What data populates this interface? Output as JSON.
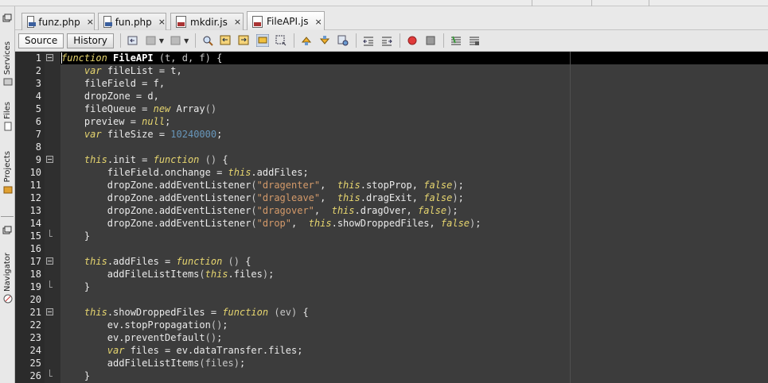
{
  "sidebar": {
    "tabs": [
      {
        "label": "Services"
      },
      {
        "label": "Files"
      },
      {
        "label": "Projects"
      },
      {
        "label": "Navigator"
      }
    ]
  },
  "tabs": [
    {
      "label": "funz.php",
      "close": "×",
      "type": "php"
    },
    {
      "label": "fun.php",
      "close": "×",
      "type": "php"
    },
    {
      "label": "mkdir.js",
      "close": "×",
      "type": "js"
    },
    {
      "label": "FileAPI.js",
      "close": "×",
      "type": "js",
      "active": true
    }
  ],
  "toolbar": {
    "source_label": "Source",
    "history_label": "History"
  },
  "editor": {
    "lines": [
      {
        "n": "1",
        "fold": "start",
        "tokens": [
          [
            "kw",
            "function"
          ],
          [
            "t",
            " "
          ],
          [
            "bold",
            "FileAPI"
          ],
          [
            "t",
            " "
          ],
          [
            "paren",
            "(t, d, f)"
          ],
          [
            "t",
            " {"
          ]
        ]
      },
      {
        "n": "2",
        "tokens": [
          [
            "t",
            "    "
          ],
          [
            "kw",
            "var"
          ],
          [
            "t",
            " fileList = t,"
          ]
        ]
      },
      {
        "n": "3",
        "tokens": [
          [
            "t",
            "    fileField = f,"
          ]
        ]
      },
      {
        "n": "4",
        "tokens": [
          [
            "t",
            "    dropZone = d,"
          ]
        ]
      },
      {
        "n": "5",
        "tokens": [
          [
            "t",
            "    fileQueue = "
          ],
          [
            "kw",
            "new"
          ],
          [
            "t",
            " Array"
          ],
          [
            "paren",
            "()"
          ]
        ]
      },
      {
        "n": "6",
        "tokens": [
          [
            "t",
            "    preview = "
          ],
          [
            "kw",
            "null"
          ],
          [
            "t",
            ";"
          ]
        ]
      },
      {
        "n": "7",
        "tokens": [
          [
            "t",
            "    "
          ],
          [
            "kw",
            "var"
          ],
          [
            "t",
            " fileSize = "
          ],
          [
            "num",
            "10240000"
          ],
          [
            "t",
            ";"
          ]
        ]
      },
      {
        "n": "8",
        "tokens": []
      },
      {
        "n": "9",
        "fold": "start",
        "tokens": [
          [
            "t",
            "    "
          ],
          [
            "kw",
            "this"
          ],
          [
            "t",
            ".init = "
          ],
          [
            "kw",
            "function"
          ],
          [
            "t",
            " "
          ],
          [
            "paren",
            "()"
          ],
          [
            "t",
            " {"
          ]
        ]
      },
      {
        "n": "10",
        "tokens": [
          [
            "t",
            "        fileField.onchange = "
          ],
          [
            "kw",
            "this"
          ],
          [
            "t",
            ".addFiles;"
          ]
        ]
      },
      {
        "n": "11",
        "tokens": [
          [
            "t",
            "        dropZone.addEventListener"
          ],
          [
            "paren",
            "("
          ],
          [
            "str",
            "\"dragenter\""
          ],
          [
            "t",
            ",  "
          ],
          [
            "kw",
            "this"
          ],
          [
            "t",
            ".stopProp, "
          ],
          [
            "kw",
            "false"
          ],
          [
            "paren",
            ")"
          ],
          [
            "t",
            ";"
          ]
        ]
      },
      {
        "n": "12",
        "tokens": [
          [
            "t",
            "        dropZone.addEventListener"
          ],
          [
            "paren",
            "("
          ],
          [
            "str",
            "\"dragleave\""
          ],
          [
            "t",
            ",  "
          ],
          [
            "kw",
            "this"
          ],
          [
            "t",
            ".dragExit, "
          ],
          [
            "kw",
            "false"
          ],
          [
            "paren",
            ")"
          ],
          [
            "t",
            ";"
          ]
        ]
      },
      {
        "n": "13",
        "tokens": [
          [
            "t",
            "        dropZone.addEventListener"
          ],
          [
            "paren",
            "("
          ],
          [
            "str",
            "\"dragover\""
          ],
          [
            "t",
            ",  "
          ],
          [
            "kw",
            "this"
          ],
          [
            "t",
            ".dragOver, "
          ],
          [
            "kw",
            "false"
          ],
          [
            "paren",
            ")"
          ],
          [
            "t",
            ";"
          ]
        ]
      },
      {
        "n": "14",
        "tokens": [
          [
            "t",
            "        dropZone.addEventListener"
          ],
          [
            "paren",
            "("
          ],
          [
            "str",
            "\"drop\""
          ],
          [
            "t",
            ",  "
          ],
          [
            "kw",
            "this"
          ],
          [
            "t",
            ".showDroppedFiles, "
          ],
          [
            "kw",
            "false"
          ],
          [
            "paren",
            ")"
          ],
          [
            "t",
            ";"
          ]
        ]
      },
      {
        "n": "15",
        "fold": "end",
        "tokens": [
          [
            "t",
            "    }"
          ]
        ]
      },
      {
        "n": "16",
        "tokens": []
      },
      {
        "n": "17",
        "fold": "start",
        "tokens": [
          [
            "t",
            "    "
          ],
          [
            "kw",
            "this"
          ],
          [
            "t",
            ".addFiles = "
          ],
          [
            "kw",
            "function"
          ],
          [
            "t",
            " "
          ],
          [
            "paren",
            "()"
          ],
          [
            "t",
            " {"
          ]
        ]
      },
      {
        "n": "18",
        "tokens": [
          [
            "t",
            "        addFileListItems"
          ],
          [
            "paren",
            "("
          ],
          [
            "kw",
            "this"
          ],
          [
            "t",
            ".files"
          ],
          [
            "paren",
            ")"
          ],
          [
            "t",
            ";"
          ]
        ]
      },
      {
        "n": "19",
        "fold": "end",
        "tokens": [
          [
            "t",
            "    }"
          ]
        ]
      },
      {
        "n": "20",
        "tokens": []
      },
      {
        "n": "21",
        "fold": "start",
        "tokens": [
          [
            "t",
            "    "
          ],
          [
            "kw",
            "this"
          ],
          [
            "t",
            ".showDroppedFiles = "
          ],
          [
            "kw",
            "function"
          ],
          [
            "t",
            " "
          ],
          [
            "paren",
            "(ev)"
          ],
          [
            "t",
            " {"
          ]
        ]
      },
      {
        "n": "22",
        "tokens": [
          [
            "t",
            "        ev.stopPropagation"
          ],
          [
            "paren",
            "()"
          ],
          [
            "t",
            ";"
          ]
        ]
      },
      {
        "n": "23",
        "tokens": [
          [
            "t",
            "        ev.preventDefault"
          ],
          [
            "paren",
            "()"
          ],
          [
            "t",
            ";"
          ]
        ]
      },
      {
        "n": "24",
        "tokens": [
          [
            "t",
            "        "
          ],
          [
            "kw",
            "var"
          ],
          [
            "t",
            " files = ev.dataTransfer.files;"
          ]
        ]
      },
      {
        "n": "25",
        "tokens": [
          [
            "t",
            "        addFileListItems"
          ],
          [
            "paren",
            "(files)"
          ],
          [
            "t",
            ";"
          ]
        ]
      },
      {
        "n": "26",
        "fold": "end",
        "tokens": [
          [
            "t",
            "    }"
          ]
        ]
      }
    ]
  },
  "colors": {
    "keyword": "#e6d56f",
    "string": "#d49a6a",
    "number": "#6897bb",
    "editor_bg": "#3c3c3c",
    "gutter_bg": "#2b2b2b"
  }
}
